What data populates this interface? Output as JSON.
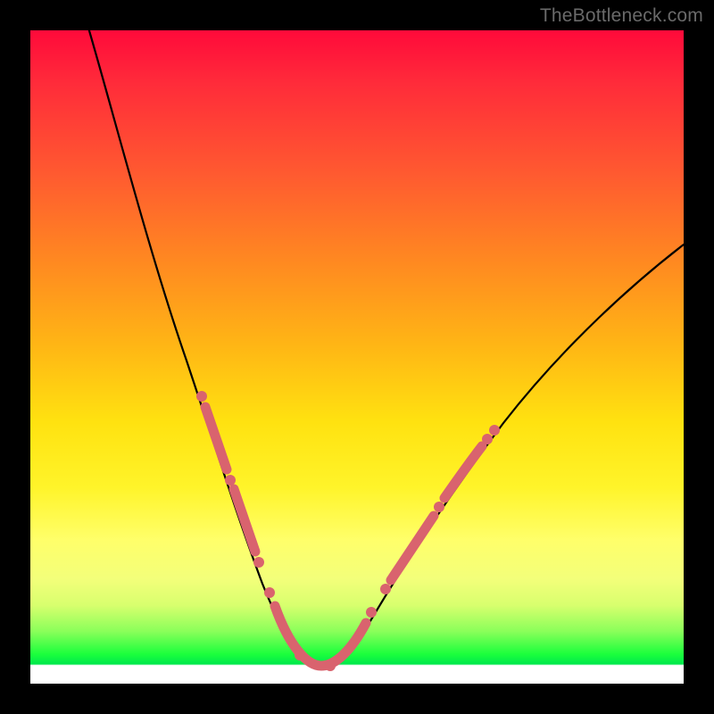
{
  "watermark": "TheBottleneck.com",
  "colors": {
    "highlight": "#d9636e",
    "curve": "#000000"
  },
  "chart_data": {
    "type": "line",
    "title": "",
    "xlabel": "",
    "ylabel": "",
    "xlim": [
      0,
      100
    ],
    "ylim": [
      0,
      100
    ],
    "grid": false,
    "legend": false,
    "background_gradient": [
      "red",
      "orange",
      "yellow",
      "green",
      "white"
    ],
    "series": [
      {
        "name": "bottleneck-curve",
        "x": [
          0,
          5,
          10,
          15,
          20,
          22,
          25,
          28,
          30,
          32,
          34,
          36,
          38,
          40,
          42,
          44,
          46,
          48,
          50,
          55,
          60,
          65,
          70,
          75,
          80,
          85,
          90,
          95,
          100
        ],
        "y": [
          100,
          92,
          82,
          72,
          60,
          55,
          46,
          37,
          30,
          22,
          15,
          9,
          5,
          2,
          1,
          2,
          5,
          9,
          14,
          24,
          33,
          41,
          48,
          54,
          59,
          63,
          67,
          70,
          73
        ]
      }
    ],
    "highlighted_points": {
      "name": "marked-points",
      "left_branch": [
        {
          "x": 25,
          "y": 46
        },
        {
          "x": 26,
          "y": 43
        },
        {
          "x": 27,
          "y": 40
        },
        {
          "x": 28,
          "y": 37
        },
        {
          "x": 29,
          "y": 34
        },
        {
          "x": 30,
          "y": 30
        },
        {
          "x": 31,
          "y": 26
        },
        {
          "x": 32,
          "y": 22
        },
        {
          "x": 33,
          "y": 18
        },
        {
          "x": 34,
          "y": 15
        }
      ],
      "trough": [
        {
          "x": 36,
          "y": 9
        },
        {
          "x": 37,
          "y": 7
        },
        {
          "x": 38,
          "y": 5
        },
        {
          "x": 39,
          "y": 3
        },
        {
          "x": 40,
          "y": 2
        },
        {
          "x": 41,
          "y": 1
        },
        {
          "x": 42,
          "y": 1
        },
        {
          "x": 43,
          "y": 2
        },
        {
          "x": 44,
          "y": 2
        },
        {
          "x": 45,
          "y": 4
        },
        {
          "x": 46,
          "y": 5
        },
        {
          "x": 47,
          "y": 7
        }
      ],
      "right_branch": [
        {
          "x": 49,
          "y": 12
        },
        {
          "x": 50,
          "y": 14
        },
        {
          "x": 51,
          "y": 16
        },
        {
          "x": 52,
          "y": 18
        },
        {
          "x": 53,
          "y": 20
        },
        {
          "x": 54,
          "y": 22
        },
        {
          "x": 55,
          "y": 24
        },
        {
          "x": 56,
          "y": 26
        },
        {
          "x": 57,
          "y": 28
        },
        {
          "x": 58,
          "y": 30
        },
        {
          "x": 59,
          "y": 32
        },
        {
          "x": 60,
          "y": 33
        },
        {
          "x": 61,
          "y": 35
        },
        {
          "x": 62,
          "y": 37
        }
      ]
    }
  }
}
